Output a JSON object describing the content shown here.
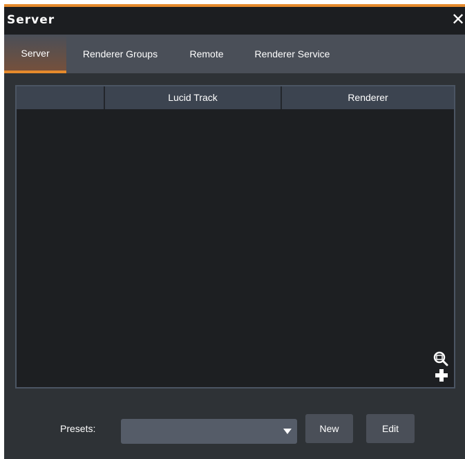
{
  "window": {
    "title": "Server",
    "close_glyph": "✕"
  },
  "tabs": [
    {
      "label": "Server",
      "active": true
    },
    {
      "label": "Renderer Groups",
      "active": false
    },
    {
      "label": "Remote",
      "active": false
    },
    {
      "label": "Renderer Service",
      "active": false
    }
  ],
  "table": {
    "columns": [
      "",
      "Lucid Track",
      "Renderer"
    ],
    "rows": []
  },
  "icons": {
    "zoom": "zoom-icon",
    "add": "add-icon"
  },
  "presets": {
    "label": "Presets:",
    "selected": ""
  },
  "buttons": {
    "new_label": "New",
    "edit_label": "Edit"
  },
  "colors": {
    "accent": "#e58a2c",
    "background": "#2e3236",
    "table_bg": "#1d1f22",
    "header_bg": "#3c4450",
    "tabbar_bg": "#4a4f58"
  }
}
